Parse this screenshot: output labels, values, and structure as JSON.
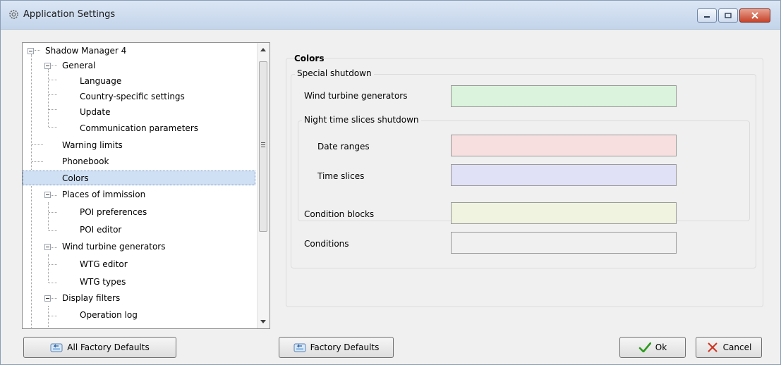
{
  "window": {
    "title": "Application Settings",
    "icons": {
      "app": "gear-icon",
      "minimize": "minimize-icon",
      "maximize": "maximize-icon",
      "close": "close-icon"
    }
  },
  "tree": {
    "items": [
      {
        "label": "Shadow Manager 4",
        "level": 0,
        "expanded": true
      },
      {
        "label": "General",
        "level": 1,
        "expanded": true
      },
      {
        "label": "Language",
        "level": 2
      },
      {
        "label": "Country-specific settings",
        "level": 2
      },
      {
        "label": "Update",
        "level": 2
      },
      {
        "label": "Communication parameters",
        "level": 2
      },
      {
        "label": "Warning limits",
        "level": 1
      },
      {
        "label": "Phonebook",
        "level": 1
      },
      {
        "label": "Colors",
        "level": 1,
        "selected": true
      },
      {
        "label": "Places of immission",
        "level": 1,
        "expanded": true
      },
      {
        "label": "POI preferences",
        "level": 2
      },
      {
        "label": "POI editor",
        "level": 2
      },
      {
        "label": "Wind turbine generators",
        "level": 1,
        "expanded": true
      },
      {
        "label": "WTG editor",
        "level": 2
      },
      {
        "label": "WTG types",
        "level": 2
      },
      {
        "label": "Display filters",
        "level": 1,
        "expanded": true
      },
      {
        "label": "Operation log",
        "level": 2
      }
    ]
  },
  "panel": {
    "title": "Colors",
    "special_shutdown": {
      "title": "Special shutdown",
      "wind_turbine_generators": {
        "label": "Wind turbine generators",
        "color": "#dbf3dc"
      },
      "night": {
        "title": "Night time slices shutdown",
        "date_ranges": {
          "label": "Date ranges",
          "color": "#f7dfe0"
        },
        "time_slices": {
          "label": "Time slices",
          "color": "#e0e0f6"
        }
      },
      "condition_blocks": {
        "label": "Condition blocks",
        "color": "#eff3df"
      },
      "conditions": {
        "label": "Conditions",
        "color": "#f0f0f0"
      }
    }
  },
  "buttons": {
    "all_factory_defaults": "All Factory Defaults",
    "factory_defaults": "Factory Defaults",
    "ok": "Ok",
    "cancel": "Cancel"
  }
}
